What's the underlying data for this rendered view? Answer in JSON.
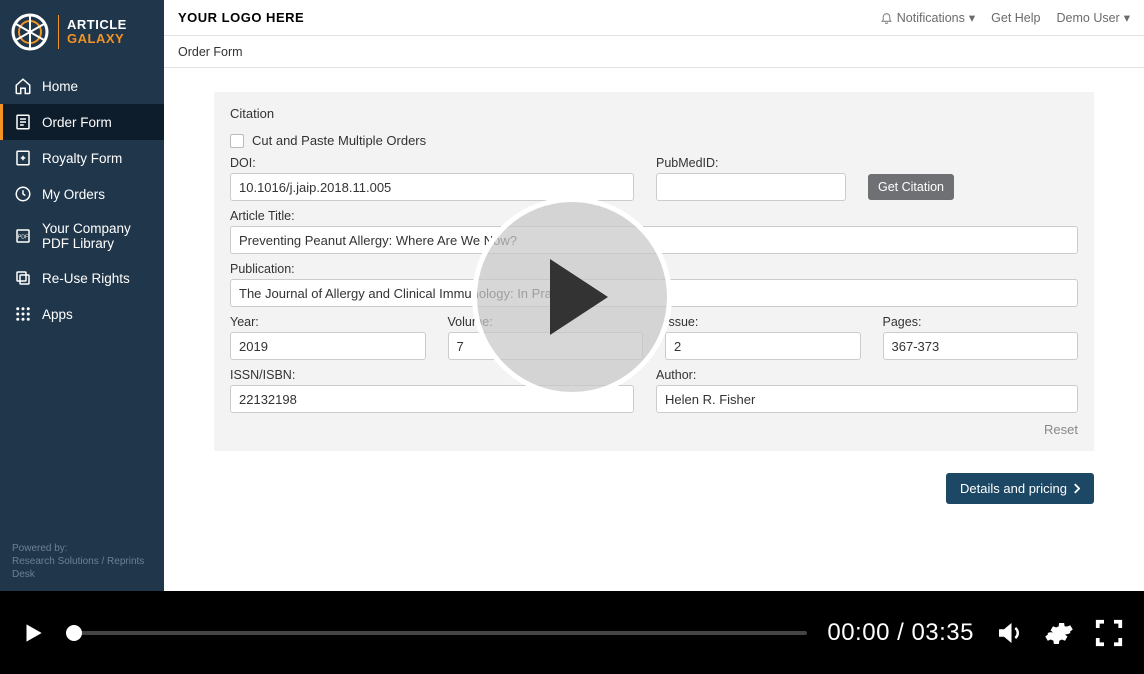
{
  "brand": {
    "line1": "ARTICLE",
    "line2": "GALAXY"
  },
  "sidebar": {
    "items": [
      {
        "label": "Home"
      },
      {
        "label": "Order Form"
      },
      {
        "label": "Royalty Form"
      },
      {
        "label": "My Orders"
      },
      {
        "label": "Your Company PDF Library"
      },
      {
        "label": "Re-Use Rights"
      },
      {
        "label": "Apps"
      }
    ],
    "footer1": "Powered by:",
    "footer2": "Research Solutions / Reprints Desk"
  },
  "topbar": {
    "logo_placeholder": "YOUR LOGO HERE",
    "notifications": "Notifications",
    "help": "Get Help",
    "user": "Demo User"
  },
  "breadcrumb": "Order Form",
  "citation": {
    "title": "Citation",
    "cut_paste_label": "Cut and Paste Multiple Orders",
    "doi_label": "DOI:",
    "doi_value": "10.1016/j.jaip.2018.11.005",
    "pubmed_label": "PubMedID:",
    "pubmed_value": "",
    "get_citation": "Get Citation",
    "article_title_label": "Article Title:",
    "article_title_value": "Preventing Peanut Allergy: Where Are We Now?",
    "publication_label": "Publication:",
    "publication_value": "The Journal of Allergy and Clinical Immunology: In Practice",
    "year_label": "Year:",
    "year_value": "2019",
    "volume_label": "Volume:",
    "volume_value": "7",
    "issue_label": "Issue:",
    "issue_value": "2",
    "pages_label": "Pages:",
    "pages_value": "367-373",
    "issn_label": "ISSN/ISBN:",
    "issn_value": "22132198",
    "author_label": "Author:",
    "author_value": "Helen R. Fisher",
    "reset": "Reset"
  },
  "details_button": "Details and pricing",
  "video": {
    "current": "00:00",
    "total": "03:35"
  }
}
